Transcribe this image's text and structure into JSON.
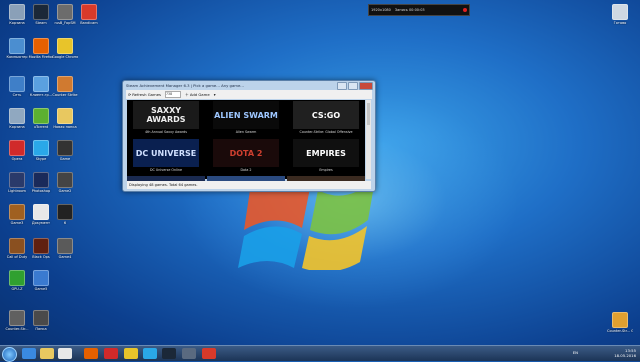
{
  "desktop": {
    "icons": [
      {
        "label": "Корзина",
        "color": "#8aa0b8"
      },
      {
        "label": "Steam",
        "color": "#1b2838"
      },
      {
        "label": "rusB_FopSM",
        "color": "#6c6c6c"
      },
      {
        "label": "Bandicam",
        "color": "#d83a2a"
      },
      {
        "label": "Компьютер",
        "color": "#4b8ed0"
      },
      {
        "label": "Mozilla Firefox",
        "color": "#e66000"
      },
      {
        "label": "Google Chrome",
        "color": "#e8c42a"
      },
      {
        "label": "Сеть",
        "color": "#3f7fc8"
      },
      {
        "label": "Клиент-гр...",
        "color": "#5aa0e0"
      },
      {
        "label": "Counter Strike",
        "color": "#d07a30"
      },
      {
        "label": "Корзина",
        "color": "#90a8c0"
      },
      {
        "label": "uTorrent",
        "color": "#5cb030"
      },
      {
        "label": "Новая папка",
        "color": "#e8c860"
      },
      {
        "label": "Opera",
        "color": "#d02a2a"
      },
      {
        "label": "Skype",
        "color": "#2aa8e8"
      },
      {
        "label": "Game",
        "color": "#333333"
      },
      {
        "label": "Lightroom",
        "color": "#2a3a6a"
      },
      {
        "label": "Photoshop",
        "color": "#1a2a5a"
      },
      {
        "label": "Game2",
        "color": "#444444"
      },
      {
        "label": "Game3",
        "color": "#a06020"
      },
      {
        "label": "Документ",
        "color": "#e8e8e8"
      },
      {
        "label": "6",
        "color": "#222222"
      },
      {
        "label": "Call of Duty",
        "color": "#8a5020"
      },
      {
        "label": "Black Ops",
        "color": "#602010"
      },
      {
        "label": "Game4",
        "color": "#5a5a5a"
      },
      {
        "label": "GPU-Z",
        "color": "#30a030"
      },
      {
        "label": "Game5",
        "color": "#3a7ad0"
      },
      {
        "label": "Counter-Str...",
        "color": "#606060"
      },
      {
        "label": "Папка",
        "color": "#4a4a4a"
      }
    ],
    "recycle_label": "Готово",
    "csgo_label": "Counter-Str... Global Offe..."
  },
  "osd": {
    "resolution": "1920x1080",
    "recording": "Запись 00:00:03"
  },
  "window": {
    "title": "Steam Achievement Manager 6.3 | Pick a game... Any game...",
    "toolbar": {
      "refresh": "Refresh Games",
      "filter_value": "738",
      "add": "Add Game"
    },
    "games": [
      {
        "art": "SAXXY AWARDS",
        "caption": "4th Annual Saxxy Awards",
        "bg": "#1a1a1a",
        "fg": "#f0f0f0"
      },
      {
        "art": "ALIEN SWARM",
        "caption": "Alien Swarm",
        "bg": "#0a0a0a",
        "fg": "#9ec7ff"
      },
      {
        "art": "CS:GO",
        "caption": "Counter-Strike: Global Offensive",
        "bg": "#202020",
        "fg": "#ffffff"
      },
      {
        "art": "DC UNIVERSE",
        "caption": "DC Universe Online",
        "bg": "#0a2050",
        "fg": "#d0e0ff"
      },
      {
        "art": "DOTA 2",
        "caption": "Dota 2",
        "bg": "#1a0a0a",
        "fg": "#d04030"
      },
      {
        "art": "EMPIRES",
        "caption": "Empires",
        "bg": "#101010",
        "fg": "#ffffff"
      }
    ],
    "status": "Displaying 48 games. Total 64 games."
  },
  "taskbar": {
    "lang": "EN",
    "time": "13:55",
    "date": "18.05.2016"
  }
}
